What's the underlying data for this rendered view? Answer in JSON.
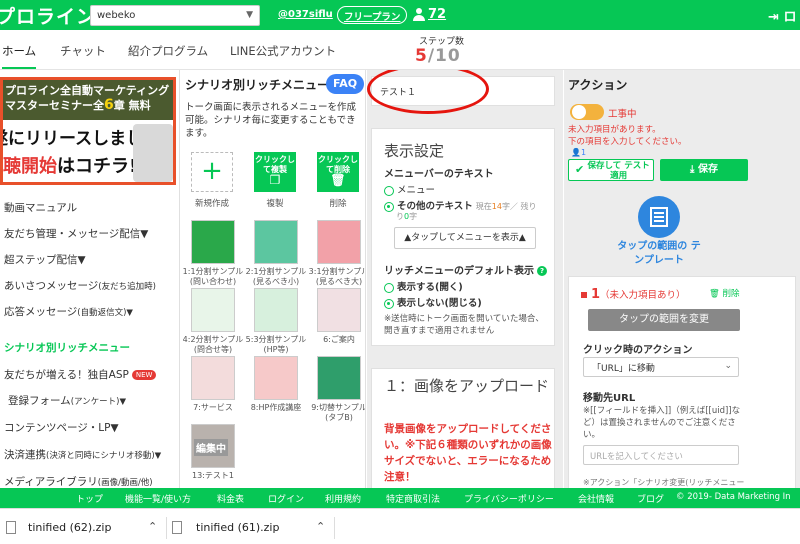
{
  "header": {
    "logo": "プロライン",
    "account_select": "webeko",
    "user_link": "@037siflu",
    "plan_badge": "フリープラン",
    "points": "72",
    "logout_label": "ロ"
  },
  "nav": {
    "tabs": [
      "ホーム",
      "チャット",
      "紹介プログラム",
      "LINE公式アカウント"
    ],
    "step_label": "ステップ数",
    "step_current": "5",
    "step_total": "/10"
  },
  "banner": {
    "line1": "プロライン全自動マーケティング",
    "line2a": "マスターセミナー全",
    "line2b": "6",
    "line2c": "章 無料",
    "line3": "遂にリリースしました!",
    "line4a": "視聴開始",
    "line4b": "はコチラ!"
  },
  "left_menu": [
    {
      "label": "動画マニュアル",
      "small": ""
    },
    {
      "label": "友だち管理・メッセージ配信▼",
      "small": ""
    },
    {
      "label": "超ステップ配信▼",
      "small": ""
    },
    {
      "label": "あいさつメッセージ",
      "small": "(友だち追加時)"
    },
    {
      "label": "応答メッセージ",
      "small": "(自動返信文)▼"
    },
    {
      "label": "シナリオ別リッチメニュー",
      "small": ""
    },
    {
      "label": "友だちが増える！独自ASP",
      "small": ""
    },
    {
      "label": "登録フォーム",
      "small": "(アンケート)▼"
    },
    {
      "label": "コンテンツページ・LP▼",
      "small": ""
    },
    {
      "label": "決済連携",
      "small": "(決済と同時にシナリオ移動)▼"
    },
    {
      "label": "メディアライブラリ",
      "small": "(画像/動画/他)"
    }
  ],
  "new_badge": "NEW",
  "richmenu": {
    "title": "シナリオ別リッチメニュー",
    "faq": "FAQ",
    "description": "トーク画面に表示されるメニューを作成可能。シナリオ毎に変更することもできます。",
    "tools": [
      {
        "button": "",
        "label": "新規作成"
      },
      {
        "button": "クリックして複製",
        "label": "複製"
      },
      {
        "button": "クリックして削除",
        "label": "削除"
      }
    ],
    "thumbs": [
      {
        "label": "1:1分割サンプル(問い合わせ)"
      },
      {
        "label": "2:1分割サンプル(見るべき小)"
      },
      {
        "label": "3:1分割サンプル(見るべき大)"
      },
      {
        "label": "4:2分割サンプル(問合せ等)"
      },
      {
        "label": "5:3分割サンプル(HP等)"
      },
      {
        "label": "6:ご案内"
      },
      {
        "label": "7:サービス"
      },
      {
        "label": "8:HP作成講座"
      },
      {
        "label": "9:切替サンプル(タブB)"
      },
      {
        "label": "13:テスト1"
      }
    ],
    "editing_badge": "編集中"
  },
  "editor": {
    "test_name": "テスト１",
    "display_title": "表示設定",
    "menubar_label": "メニューバーのテキスト",
    "opt_menu": "メニュー",
    "opt_other": "その他のテキスト",
    "other_note_a": "現在",
    "other_note_count": "14",
    "other_note_b": "字／ 残り",
    "other_note_remain": "0",
    "other_note_c": "字",
    "show_menu_button": "▲タップしてメニューを表示▲",
    "default_label": "リッチメニューのデフォルト表示",
    "opt_show": "表示する(開く)",
    "opt_hide": "表示しない(閉じる)",
    "note": "※送信時にトーク画面を開いていた場合、開き直すまで適用されません",
    "upload_title": "１：画像をアップロード",
    "upload_warning": "背景画像をアップロードしてください。※下記６種類のいずれかの画像サイズでないと、エラーになるため注意！"
  },
  "action": {
    "title": "アクション",
    "toggle_label": "工事中",
    "warn1": "未入力項目があります。",
    "warn2": "下の項目を入力してください。",
    "count": "1",
    "save_apply": "保存して テスト適用",
    "save": "保存",
    "template_label": "タップの範囲の テンプレート",
    "num": "1",
    "num_msg": "（未入力項目あり）",
    "delete": "削除",
    "change_range": "タップの範囲を変更",
    "click_action_label": "クリック時のアクション",
    "click_action_value": "「URL」に移動",
    "dest_label": "移動先URL",
    "dest_note": "※[[フィールドを挿入]]（例えば[[uid]]など）は置換されませんのでご注意ください。",
    "url_placeholder": "URLを記入してください",
    "cut_text": "※アクション「シナリオ変更(リッチメニュー"
  },
  "footer": {
    "links": [
      "トップ",
      "機能一覧/使い方",
      "料金表",
      "ログイン",
      "利用規約",
      "特定商取引法",
      "プライバシーポリシー",
      "会社情報",
      "ブログ"
    ],
    "copyright": "© 2019- Data Marketing In"
  },
  "downloads": [
    {
      "name": "tinified (62).zip"
    },
    {
      "name": "tinified (61).zip"
    }
  ],
  "colors": {
    "brand": "#06c755",
    "alert": "#e53935",
    "link_blue": "#2e86de"
  }
}
